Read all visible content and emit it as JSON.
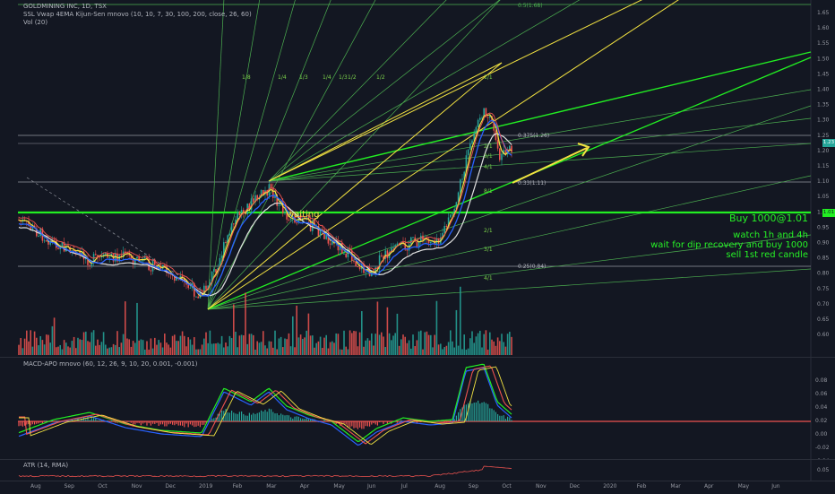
{
  "header": {
    "symbol_line": "GOLDMINING INC, 1D, TSX",
    "indicator_line": "SSL Vwap 4EMA Kijun-Sen mnovo (10, 10, 7, 30, 100, 200, close, 26, 60)",
    "volume_line": "Vol (20)"
  },
  "macd": {
    "legend": "MACD-APO mnovo (60, 12, 26, 9, 10, 20, 0.001, -0.001)",
    "ticks": [
      "0.08",
      "0.06",
      "0.04",
      "0.02",
      "0.00",
      "-0.02",
      "-0.04"
    ]
  },
  "atr": {
    "legend": "ATR (14, RMA)",
    "ticks": [
      "0.05"
    ]
  },
  "price_axis": {
    "ticks": [
      "1.65",
      "1.60",
      "1.55",
      "1.50",
      "1.45",
      "1.40",
      "1.35",
      "1.30",
      "1.25",
      "1.20",
      "1.15",
      "1.10",
      "1.05",
      "1.00",
      "0.95",
      "0.90",
      "0.85",
      "0.80",
      "0.75",
      "0.70",
      "0.65",
      "0.60"
    ],
    "current_price": "1.23",
    "buy_level": "1.01"
  },
  "time_axis": {
    "labels": [
      "Aug",
      "Sep",
      "Oct",
      "Nov",
      "Dec",
      "2019",
      "Feb",
      "Mar",
      "Apr",
      "May",
      "Jun",
      "Jul",
      "Aug",
      "Sep",
      "Oct",
      "Nov",
      "Dec",
      "2020",
      "Feb",
      "Mar",
      "Apr",
      "May",
      "Jun"
    ]
  },
  "fib_labels": {
    "top": "0.5(1.68)",
    "l1": "0.375(1.26)",
    "l2": "0.33(1.11)",
    "l3": "0.25(0.84)"
  },
  "gann_labels": [
    "1/8",
    "1/4",
    "1/3",
    "1/4",
    "1/3",
    "1/2",
    "1/2",
    "1/1",
    "2/1",
    "3/1",
    "4/1",
    "8/1",
    "2/1",
    "3/1",
    "4/1",
    "8/1"
  ],
  "annotations": {
    "waiting": "waiting",
    "buy": "Buy 1000@1.01",
    "watch": "watch 1h and 4h",
    "wait": "wait for dip recovery and buy 1000",
    "sell": "sell 1st red candle"
  },
  "colors": {
    "bg": "#131722",
    "green_line": "#22ee22",
    "yellow_line": "#f2e241",
    "blue_line": "#2962ff",
    "red_candle": "#ef5350",
    "green_candle": "#26a69a"
  }
}
